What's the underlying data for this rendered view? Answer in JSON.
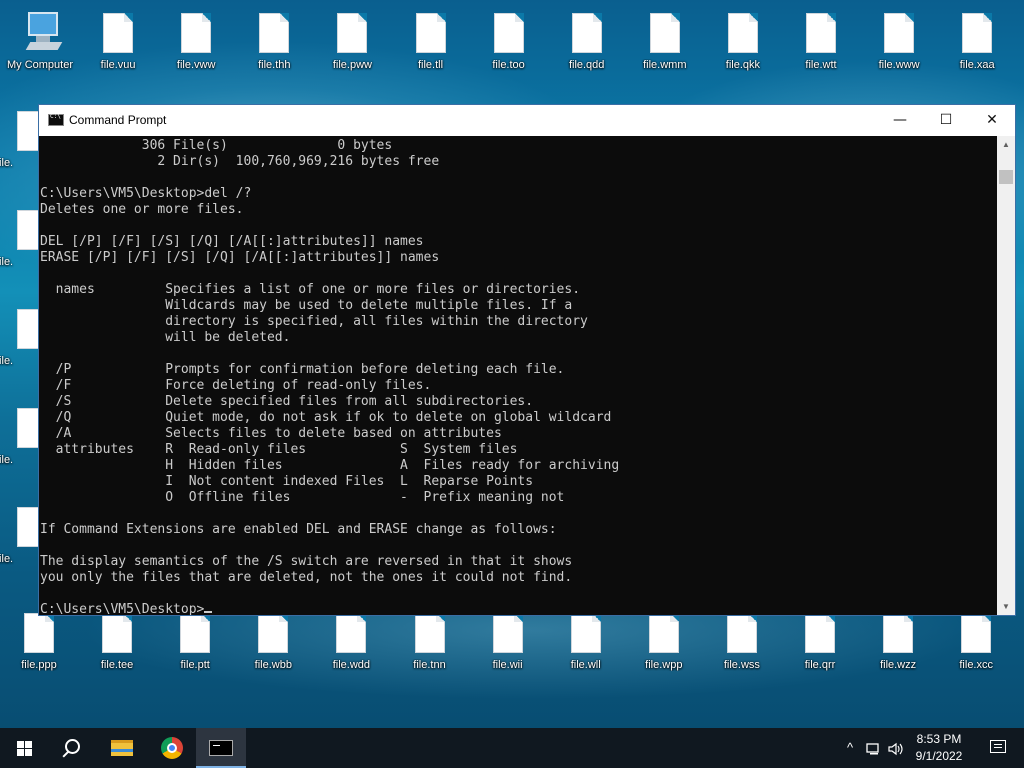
{
  "desktop": {
    "top_row": [
      {
        "label": "My Computer",
        "kind": "computer"
      },
      {
        "label": "file.vuu"
      },
      {
        "label": "file.vww"
      },
      {
        "label": "file.thh"
      },
      {
        "label": "file.pww"
      },
      {
        "label": "file.tll"
      },
      {
        "label": "file.too"
      },
      {
        "label": "file.qdd"
      },
      {
        "label": "file.wmm"
      },
      {
        "label": "file.qkk"
      },
      {
        "label": "file.wtt"
      },
      {
        "label": "file.www"
      },
      {
        "label": "file.xaa"
      }
    ],
    "left_column": [
      {
        "label": "file."
      },
      {
        "label": "file."
      },
      {
        "label": "file."
      },
      {
        "label": "file."
      },
      {
        "label": "file."
      }
    ],
    "bottom_row": [
      {
        "label": "file.ppp"
      },
      {
        "label": "file.tee"
      },
      {
        "label": "file.ptt"
      },
      {
        "label": "file.wbb"
      },
      {
        "label": "file.wdd"
      },
      {
        "label": "file.tnn"
      },
      {
        "label": "file.wii"
      },
      {
        "label": "file.wll"
      },
      {
        "label": "file.wpp"
      },
      {
        "label": "file.wss"
      },
      {
        "label": "file.qrr"
      },
      {
        "label": "file.wzz"
      },
      {
        "label": "file.xcc"
      }
    ]
  },
  "window": {
    "title": "Command Prompt",
    "minimize": "—",
    "maximize": "☐",
    "close": "✕",
    "console_lines": [
      "             306 File(s)              0 bytes",
      "               2 Dir(s)  100,760,969,216 bytes free",
      "",
      "C:\\Users\\VM5\\Desktop>del /?",
      "Deletes one or more files.",
      "",
      "DEL [/P] [/F] [/S] [/Q] [/A[[:]attributes]] names",
      "ERASE [/P] [/F] [/S] [/Q] [/A[[:]attributes]] names",
      "",
      "  names         Specifies a list of one or more files or directories.",
      "                Wildcards may be used to delete multiple files. If a",
      "                directory is specified, all files within the directory",
      "                will be deleted.",
      "",
      "  /P            Prompts for confirmation before deleting each file.",
      "  /F            Force deleting of read-only files.",
      "  /S            Delete specified files from all subdirectories.",
      "  /Q            Quiet mode, do not ask if ok to delete on global wildcard",
      "  /A            Selects files to delete based on attributes",
      "  attributes    R  Read-only files            S  System files",
      "                H  Hidden files               A  Files ready for archiving",
      "                I  Not content indexed Files  L  Reparse Points",
      "                O  Offline files              -  Prefix meaning not",
      "",
      "If Command Extensions are enabled DEL and ERASE change as follows:",
      "",
      "The display semantics of the /S switch are reversed in that it shows",
      "you only the files that are deleted, not the ones it could not find.",
      ""
    ],
    "prompt": "C:\\Users\\VM5\\Desktop>"
  },
  "taskbar": {
    "time": "8:53 PM",
    "date": "9/1/2022",
    "tray_chevron": "^",
    "colors": {
      "background": "#101820",
      "active_indicator": "#7fb3e6"
    }
  }
}
